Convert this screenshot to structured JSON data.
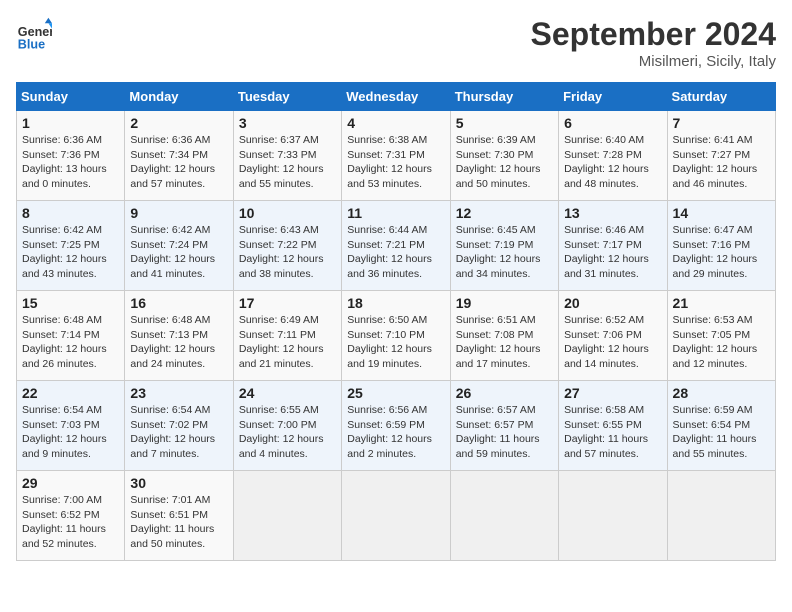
{
  "header": {
    "logo_line1": "General",
    "logo_line2": "Blue",
    "month": "September 2024",
    "location": "Misilmeri, Sicily, Italy"
  },
  "weekdays": [
    "Sunday",
    "Monday",
    "Tuesday",
    "Wednesday",
    "Thursday",
    "Friday",
    "Saturday"
  ],
  "weeks": [
    [
      {
        "day": "1",
        "info": "Sunrise: 6:36 AM\nSunset: 7:36 PM\nDaylight: 13 hours\nand 0 minutes."
      },
      {
        "day": "2",
        "info": "Sunrise: 6:36 AM\nSunset: 7:34 PM\nDaylight: 12 hours\nand 57 minutes."
      },
      {
        "day": "3",
        "info": "Sunrise: 6:37 AM\nSunset: 7:33 PM\nDaylight: 12 hours\nand 55 minutes."
      },
      {
        "day": "4",
        "info": "Sunrise: 6:38 AM\nSunset: 7:31 PM\nDaylight: 12 hours\nand 53 minutes."
      },
      {
        "day": "5",
        "info": "Sunrise: 6:39 AM\nSunset: 7:30 PM\nDaylight: 12 hours\nand 50 minutes."
      },
      {
        "day": "6",
        "info": "Sunrise: 6:40 AM\nSunset: 7:28 PM\nDaylight: 12 hours\nand 48 minutes."
      },
      {
        "day": "7",
        "info": "Sunrise: 6:41 AM\nSunset: 7:27 PM\nDaylight: 12 hours\nand 46 minutes."
      }
    ],
    [
      {
        "day": "8",
        "info": "Sunrise: 6:42 AM\nSunset: 7:25 PM\nDaylight: 12 hours\nand 43 minutes."
      },
      {
        "day": "9",
        "info": "Sunrise: 6:42 AM\nSunset: 7:24 PM\nDaylight: 12 hours\nand 41 minutes."
      },
      {
        "day": "10",
        "info": "Sunrise: 6:43 AM\nSunset: 7:22 PM\nDaylight: 12 hours\nand 38 minutes."
      },
      {
        "day": "11",
        "info": "Sunrise: 6:44 AM\nSunset: 7:21 PM\nDaylight: 12 hours\nand 36 minutes."
      },
      {
        "day": "12",
        "info": "Sunrise: 6:45 AM\nSunset: 7:19 PM\nDaylight: 12 hours\nand 34 minutes."
      },
      {
        "day": "13",
        "info": "Sunrise: 6:46 AM\nSunset: 7:17 PM\nDaylight: 12 hours\nand 31 minutes."
      },
      {
        "day": "14",
        "info": "Sunrise: 6:47 AM\nSunset: 7:16 PM\nDaylight: 12 hours\nand 29 minutes."
      }
    ],
    [
      {
        "day": "15",
        "info": "Sunrise: 6:48 AM\nSunset: 7:14 PM\nDaylight: 12 hours\nand 26 minutes."
      },
      {
        "day": "16",
        "info": "Sunrise: 6:48 AM\nSunset: 7:13 PM\nDaylight: 12 hours\nand 24 minutes."
      },
      {
        "day": "17",
        "info": "Sunrise: 6:49 AM\nSunset: 7:11 PM\nDaylight: 12 hours\nand 21 minutes."
      },
      {
        "day": "18",
        "info": "Sunrise: 6:50 AM\nSunset: 7:10 PM\nDaylight: 12 hours\nand 19 minutes."
      },
      {
        "day": "19",
        "info": "Sunrise: 6:51 AM\nSunset: 7:08 PM\nDaylight: 12 hours\nand 17 minutes."
      },
      {
        "day": "20",
        "info": "Sunrise: 6:52 AM\nSunset: 7:06 PM\nDaylight: 12 hours\nand 14 minutes."
      },
      {
        "day": "21",
        "info": "Sunrise: 6:53 AM\nSunset: 7:05 PM\nDaylight: 12 hours\nand 12 minutes."
      }
    ],
    [
      {
        "day": "22",
        "info": "Sunrise: 6:54 AM\nSunset: 7:03 PM\nDaylight: 12 hours\nand 9 minutes."
      },
      {
        "day": "23",
        "info": "Sunrise: 6:54 AM\nSunset: 7:02 PM\nDaylight: 12 hours\nand 7 minutes."
      },
      {
        "day": "24",
        "info": "Sunrise: 6:55 AM\nSunset: 7:00 PM\nDaylight: 12 hours\nand 4 minutes."
      },
      {
        "day": "25",
        "info": "Sunrise: 6:56 AM\nSunset: 6:59 PM\nDaylight: 12 hours\nand 2 minutes."
      },
      {
        "day": "26",
        "info": "Sunrise: 6:57 AM\nSunset: 6:57 PM\nDaylight: 11 hours\nand 59 minutes."
      },
      {
        "day": "27",
        "info": "Sunrise: 6:58 AM\nSunset: 6:55 PM\nDaylight: 11 hours\nand 57 minutes."
      },
      {
        "day": "28",
        "info": "Sunrise: 6:59 AM\nSunset: 6:54 PM\nDaylight: 11 hours\nand 55 minutes."
      }
    ],
    [
      {
        "day": "29",
        "info": "Sunrise: 7:00 AM\nSunset: 6:52 PM\nDaylight: 11 hours\nand 52 minutes."
      },
      {
        "day": "30",
        "info": "Sunrise: 7:01 AM\nSunset: 6:51 PM\nDaylight: 11 hours\nand 50 minutes."
      },
      {
        "day": "",
        "info": ""
      },
      {
        "day": "",
        "info": ""
      },
      {
        "day": "",
        "info": ""
      },
      {
        "day": "",
        "info": ""
      },
      {
        "day": "",
        "info": ""
      }
    ]
  ]
}
